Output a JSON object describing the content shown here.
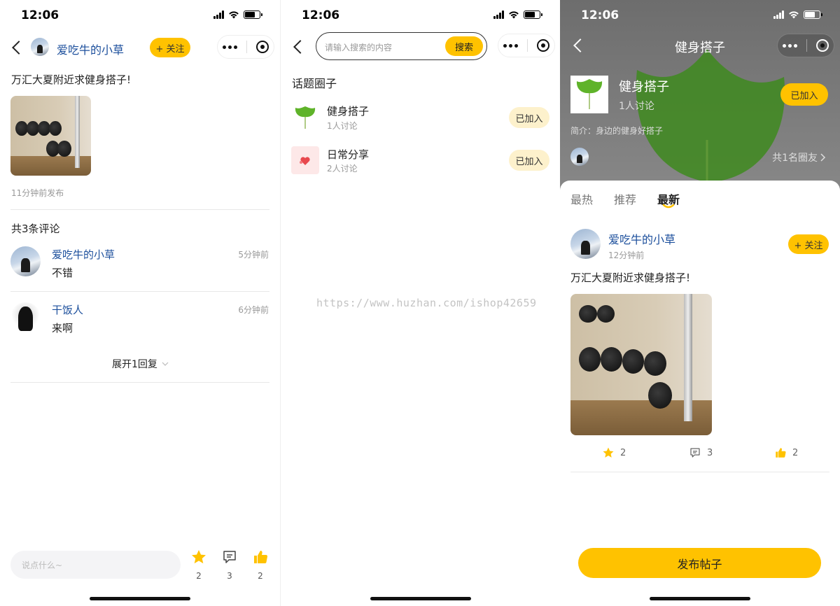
{
  "status": {
    "time": "12:06"
  },
  "screen1": {
    "author_name": "爱吃牛的小草",
    "follow_label": "+ 关注",
    "post_text": "万汇大夏附近求健身搭子!",
    "post_time": "11分钟前发布",
    "comments_header": "共3条评论",
    "comments": [
      {
        "name": "爱吃牛的小草",
        "time": "5分钟前",
        "text": "不错"
      },
      {
        "name": "干饭人",
        "time": "6分钟前",
        "text": "来啊"
      }
    ],
    "expand_label": "展开1回复",
    "input_placeholder": "说点什么~",
    "actions": {
      "star": "2",
      "comment": "3",
      "like": "2"
    }
  },
  "screen2": {
    "search_placeholder": "请输入搜索的内容",
    "search_button": "搜索",
    "section_title": "话题圈子",
    "circles": [
      {
        "name": "健身搭子",
        "count": "1人讨论",
        "action": "已加入"
      },
      {
        "name": "日常分享",
        "count": "2人讨论",
        "action": "已加入"
      }
    ]
  },
  "screen3": {
    "title": "健身搭子",
    "circle_name": "健身搭子",
    "circle_count": "1人讨论",
    "joined_label": "已加入",
    "intro": "简介：身边的健身好搭子",
    "members_label": "共1名圈友",
    "tabs": [
      "最热",
      "推荐",
      "最新"
    ],
    "post": {
      "author": "爱吃牛的小草",
      "time": "12分钟前",
      "follow": "+ 关注",
      "text": "万汇大夏附近求健身搭子!",
      "star": "2",
      "comment": "3",
      "like": "2"
    },
    "publish_button": "发布帖子"
  },
  "watermark": "https://www.huzhan.com/ishop42659",
  "colors": {
    "accent": "#ffc200",
    "link": "#1c4f9c",
    "joined_bg": "#fdf1cc"
  }
}
